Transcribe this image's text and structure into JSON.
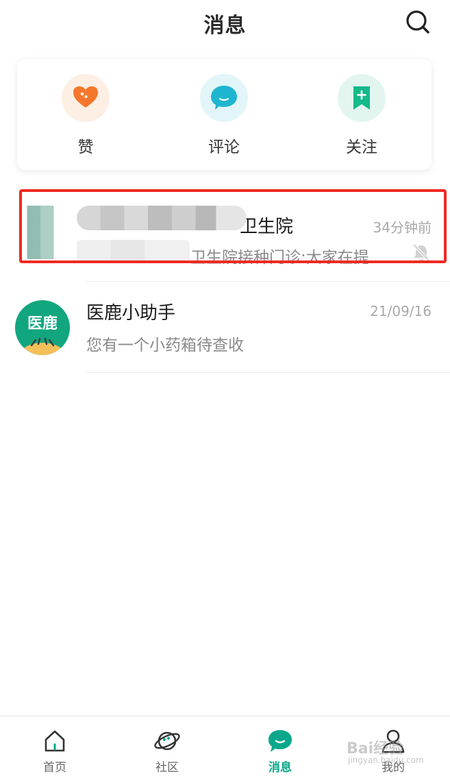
{
  "header": {
    "title": "消息"
  },
  "quick_actions": [
    {
      "label": "赞",
      "icon": "heart-icon",
      "color": "#f5772b",
      "bg": "#fdefe3"
    },
    {
      "label": "评论",
      "icon": "comment-bubble-icon",
      "color": "#1eb5d0",
      "bg": "#e2f5f8"
    },
    {
      "label": "关注",
      "icon": "bookmark-plus-icon",
      "color": "#15b98a",
      "bg": "#e2f6ef"
    }
  ],
  "messages": [
    {
      "name": "卫生院",
      "time": "34分钟前",
      "preview": "卫生院接种门诊:大家在提…",
      "muted": true
    },
    {
      "name": "医鹿小助手",
      "time": "21/09/16",
      "preview": "您有一个小药箱待查收",
      "avatar_text": "医鹿"
    }
  ],
  "tabbar": [
    {
      "label": "首页",
      "icon": "home-icon"
    },
    {
      "label": "社区",
      "icon": "planet-icon"
    },
    {
      "label": "消息",
      "icon": "chat-bubble-icon",
      "active": true
    },
    {
      "label": "我的",
      "icon": "user-icon"
    }
  ],
  "watermark": {
    "text": "Bai经验",
    "sub": "jingyan.baidu.com"
  },
  "colors": {
    "accent": "#0aa88a",
    "highlight": "#ee2a22"
  }
}
